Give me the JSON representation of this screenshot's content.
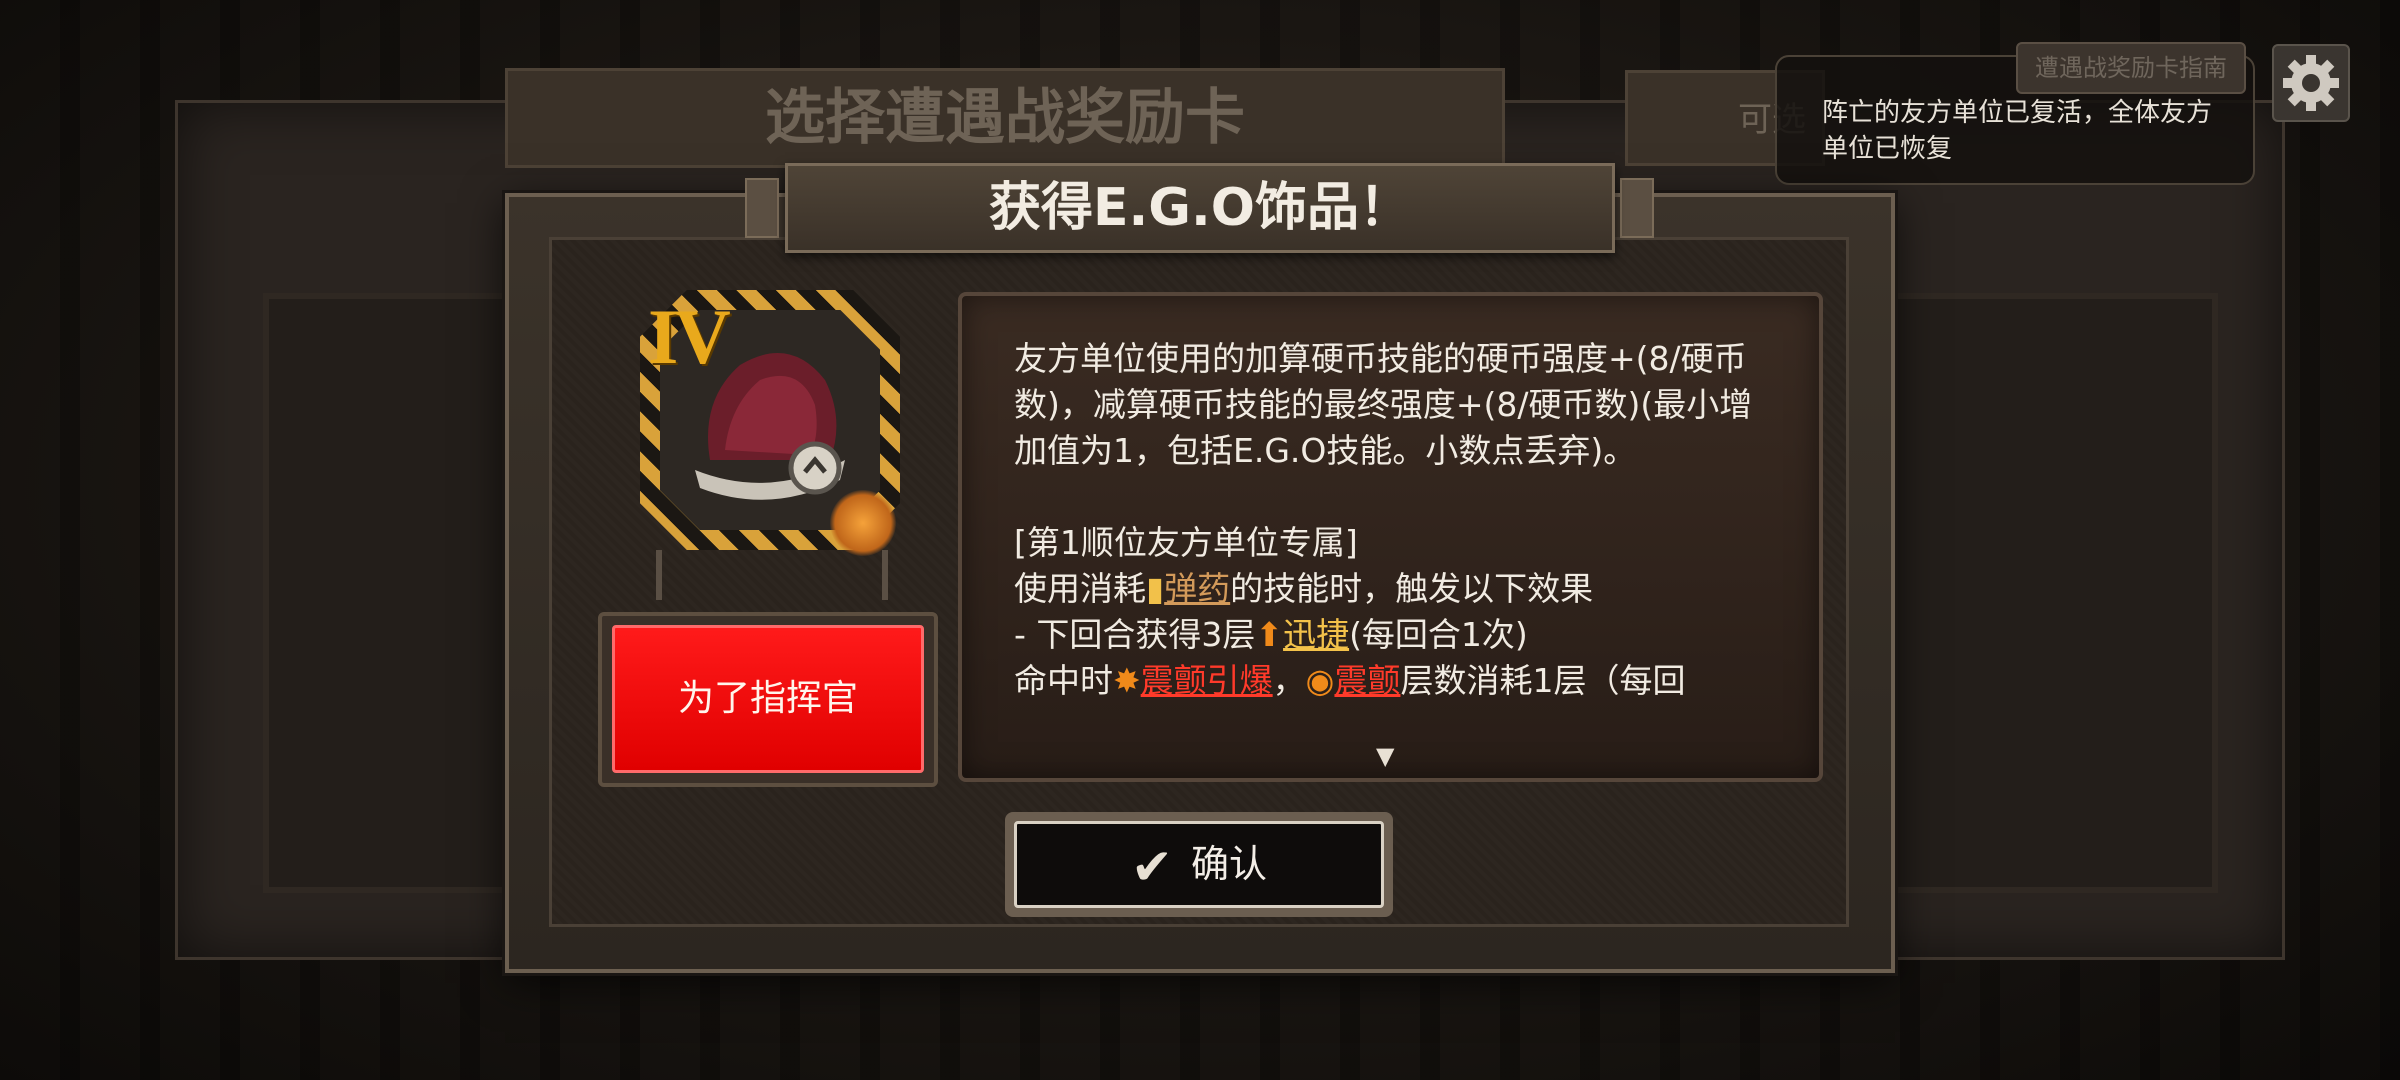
{
  "background": {
    "title": "选择遭遇战奖励卡",
    "right_plate_text": "可选",
    "guide_button": "遭遇战奖励卡指南"
  },
  "notice": {
    "text": "阵亡的友方单位已复活，全体友方单位已恢复"
  },
  "modal": {
    "title": "获得E.G.O饰品！",
    "item": {
      "tier": "IV",
      "icon": "crimson-hat-icon",
      "badge_icon": "resonance-icon"
    },
    "choice_button": "为了指挥官",
    "description": {
      "line1": "友方单位使用的加算硬币技能的硬币强度+(8/硬币数)，减算硬币技能的最终强度+(8/硬币数)(最小增加值为1，包括E.G.O技能。小数点丢弃)。",
      "section_header": "[第1顺位友方单位专属]",
      "line2_pre": "使用消耗",
      "ammo": "弹药",
      "line2_post": "的技能时，触发以下效果",
      "line3_pre": "- 下回合获得3层",
      "haste": "迅捷",
      "line3_post": "(每回合1次)",
      "line4_pre": "命中时",
      "tremor_burst": "震颤引爆",
      "line4_mid": "，",
      "tremor": "震颤",
      "line4_post": "层数消耗1层（每回"
    },
    "confirm_button": "确认"
  },
  "colors": {
    "accent_red": "#ff1a1a",
    "tier_gold": "#e9a91c",
    "keyword_ammo": "#d39a5a",
    "keyword_haste": "#f4c24a",
    "keyword_tremor": "#ff3a2a"
  }
}
